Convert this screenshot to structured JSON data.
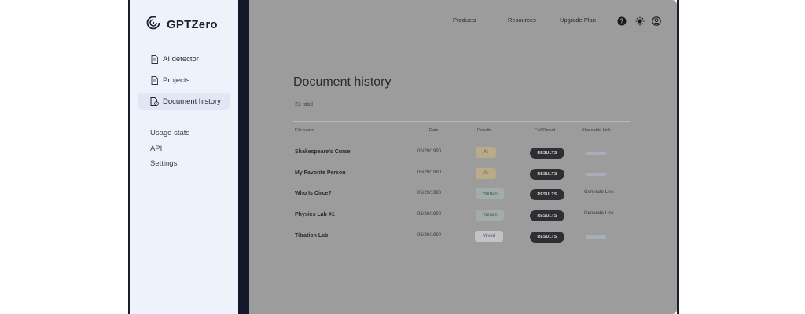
{
  "brand": {
    "name": "GPTZero"
  },
  "sidebar": {
    "items": [
      {
        "label": "AI detector",
        "icon": "file-icon"
      },
      {
        "label": "Projects",
        "icon": "file-icon"
      },
      {
        "label": "Document history",
        "icon": "history-file-icon",
        "active": true
      }
    ],
    "links": [
      "Usage stats",
      "API",
      "Settings"
    ]
  },
  "topnav": {
    "links": [
      "Products",
      "Resources",
      "Upgrade Plan"
    ],
    "icons": [
      "help-icon",
      "theme-sun-icon",
      "account-icon"
    ]
  },
  "page": {
    "title": "Document history",
    "total": "23 total"
  },
  "table": {
    "headers": [
      "File name",
      "Date",
      "Results",
      "Full Result",
      "Shareable Link"
    ],
    "button_label": "RESULTS",
    "rows": [
      {
        "name": "Shakespeare's Curse",
        "date": "05/29/1990",
        "result": "AI",
        "result_type": "ai",
        "share": ""
      },
      {
        "name": "My Favorite Person",
        "date": "05/29/1990",
        "result": "AI",
        "result_type": "ai",
        "share": ""
      },
      {
        "name": "Who Is Circe?",
        "date": "05/29/1990",
        "result": "Human",
        "result_type": "human",
        "share": "Generate Link"
      },
      {
        "name": "Physics Lab #1",
        "date": "05/29/1990",
        "result": "Human",
        "result_type": "human",
        "share": "Generate Link"
      },
      {
        "name": "Titration Lab",
        "date": "05/29/1990",
        "result": "Mixed",
        "result_type": "mixed",
        "share": ""
      }
    ]
  },
  "colors": {
    "sidebar_bg": "#eef2fb",
    "main_overlay": "#9c9c9c",
    "button_bg": "#2e2f33"
  }
}
